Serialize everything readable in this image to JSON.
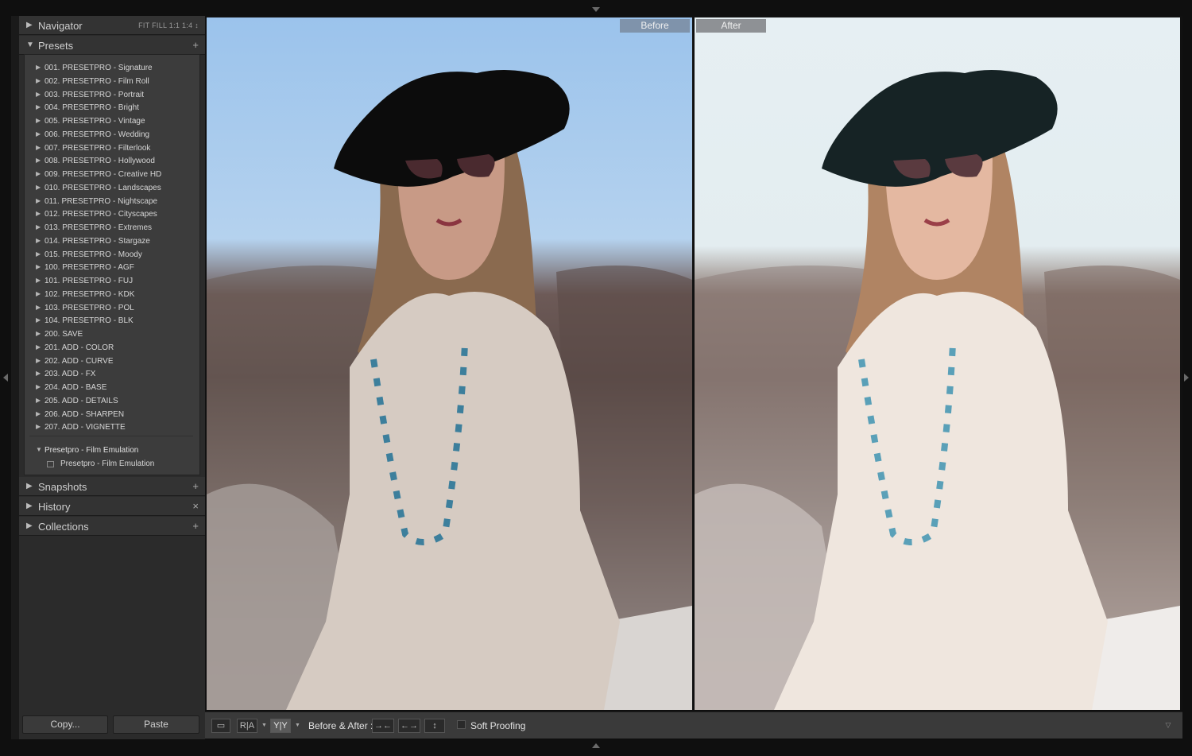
{
  "left_panel": {
    "navigator": {
      "title": "Navigator",
      "zoom_options": "FIT   FILL   1:1   1:4  ↕"
    },
    "presets": {
      "title": "Presets",
      "add_icon": "+",
      "items": [
        "001. PRESETPRO - Signature",
        "002. PRESETPRO - Film Roll",
        "003. PRESETPRO - Portrait",
        "004. PRESETPRO - Bright",
        "005. PRESETPRO - Vintage",
        "006. PRESETPRO - Wedding",
        "007. PRESETPRO - Filterlook",
        "008. PRESETPRO - Hollywood",
        "009. PRESETPRO - Creative HD",
        "010. PRESETPRO - Landscapes",
        "011. PRESETPRO - Nightscape",
        "012. PRESETPRO - Cityscapes",
        "013. PRESETPRO - Extremes",
        "014. PRESETPRO - Stargaze",
        "015. PRESETPRO - Moody",
        "100. PRESETPRO - AGF",
        "101. PRESETPRO - FUJ",
        "102. PRESETPRO - KDK",
        "103. PRESETPRO - POL",
        "104. PRESETPRO - BLK",
        "200. SAVE",
        "201. ADD - COLOR",
        "202. ADD - CURVE",
        "203. ADD - FX",
        "204. ADD - BASE",
        "205. ADD - DETAILS",
        "206. ADD - SHARPEN",
        "207. ADD - VIGNETTE"
      ],
      "user_folder": "Presetpro - Film Emulation",
      "user_preset": "Presetpro - Film Emulation"
    },
    "snapshots": {
      "title": "Snapshots",
      "action": "+"
    },
    "history": {
      "title": "History",
      "action": "×"
    },
    "collections": {
      "title": "Collections",
      "action": "+"
    },
    "copy_label": "Copy...",
    "paste_label": "Paste"
  },
  "compare": {
    "before_label": "Before",
    "after_label": "After"
  },
  "toolbar": {
    "loupe_view": "▭",
    "ra_view": "R|A",
    "yy_view": "Y|Y",
    "before_after_label": "Before & After :",
    "swap_left": "→←",
    "swap_right": "←→",
    "copy_settings": "↕",
    "soft_proofing_label": "Soft Proofing",
    "menu_icon": "▽"
  }
}
